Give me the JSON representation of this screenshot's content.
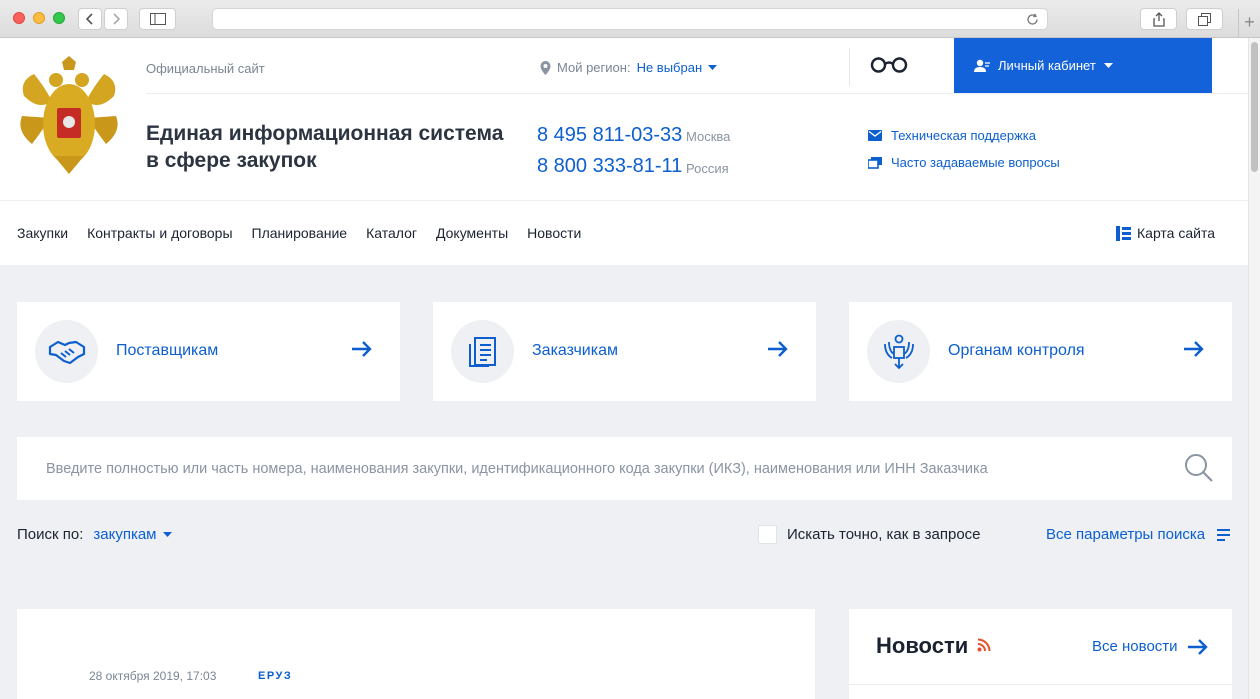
{
  "header": {
    "official_label": "Официальный сайт",
    "region_label": "Мой регион:",
    "region_value": "Не выбран",
    "cabinet_label": "Личный кабинет",
    "title_line1": "Единая информационная система",
    "title_line2": "в сфере закупок",
    "phones": [
      {
        "number": "8 495 811-03-33",
        "city": "Москва"
      },
      {
        "number": "8 800 333-81-11",
        "city": "Россия"
      }
    ],
    "support_link": "Техническая поддержка",
    "faq_link": "Часто задаваемые вопросы"
  },
  "menu": {
    "items": [
      "Закупки",
      "Контракты и договоры",
      "Планирование",
      "Каталог",
      "Документы",
      "Новости"
    ],
    "sitemap": "Карта сайта"
  },
  "cards": [
    {
      "label": "Поставщикам",
      "icon": "handshake-icon"
    },
    {
      "label": "Заказчикам",
      "icon": "document-icon"
    },
    {
      "label": "Органам контроля",
      "icon": "emblem-icon"
    }
  ],
  "search": {
    "placeholder": "Введите полностью или часть номера, наименования закупки, идентификационного кода закупки (ИКЗ), наименования или ИНН Заказчика",
    "search_by_label": "Поиск по:",
    "search_by_value": "закупкам",
    "exact_label": "Искать точно, как в запросе",
    "all_params": "Все параметры поиска"
  },
  "news_feed": {
    "date": "28 октября 2019, 17:03",
    "tag": "ЕРУЗ"
  },
  "news_panel": {
    "title": "Новости",
    "all_link": "Все новости"
  },
  "colors": {
    "accent": "#0d5fcf",
    "cabinet_bg": "#1462d9",
    "page_bg": "#eef0f4",
    "rss": "#e8502a"
  }
}
